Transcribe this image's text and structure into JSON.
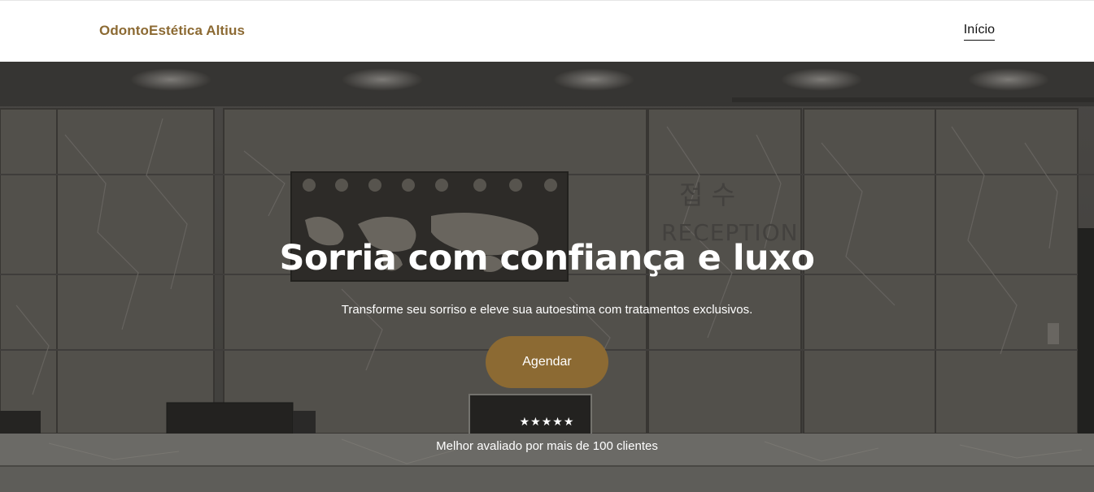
{
  "header": {
    "brand": "OdontoEstética Altius",
    "nav": [
      {
        "label": "Início"
      }
    ]
  },
  "hero": {
    "title": "Sorria com confiança e luxo",
    "subtitle": "Transforme seu sorriso e eleve sua autoestima com tratamentos exclusivos.",
    "cta_label": "Agendar",
    "rating": {
      "stars_text": "★★★★★",
      "stars_value": 5,
      "stars_max": 5,
      "text": "Melhor avaliado por mais de 100 clientes"
    },
    "background": {
      "sign_korean": "접 수",
      "sign_english": "RECEPTION"
    }
  },
  "colors": {
    "brand": "#8c6a33",
    "button": "#8c6a33",
    "overlay": "#3f3d3b"
  }
}
